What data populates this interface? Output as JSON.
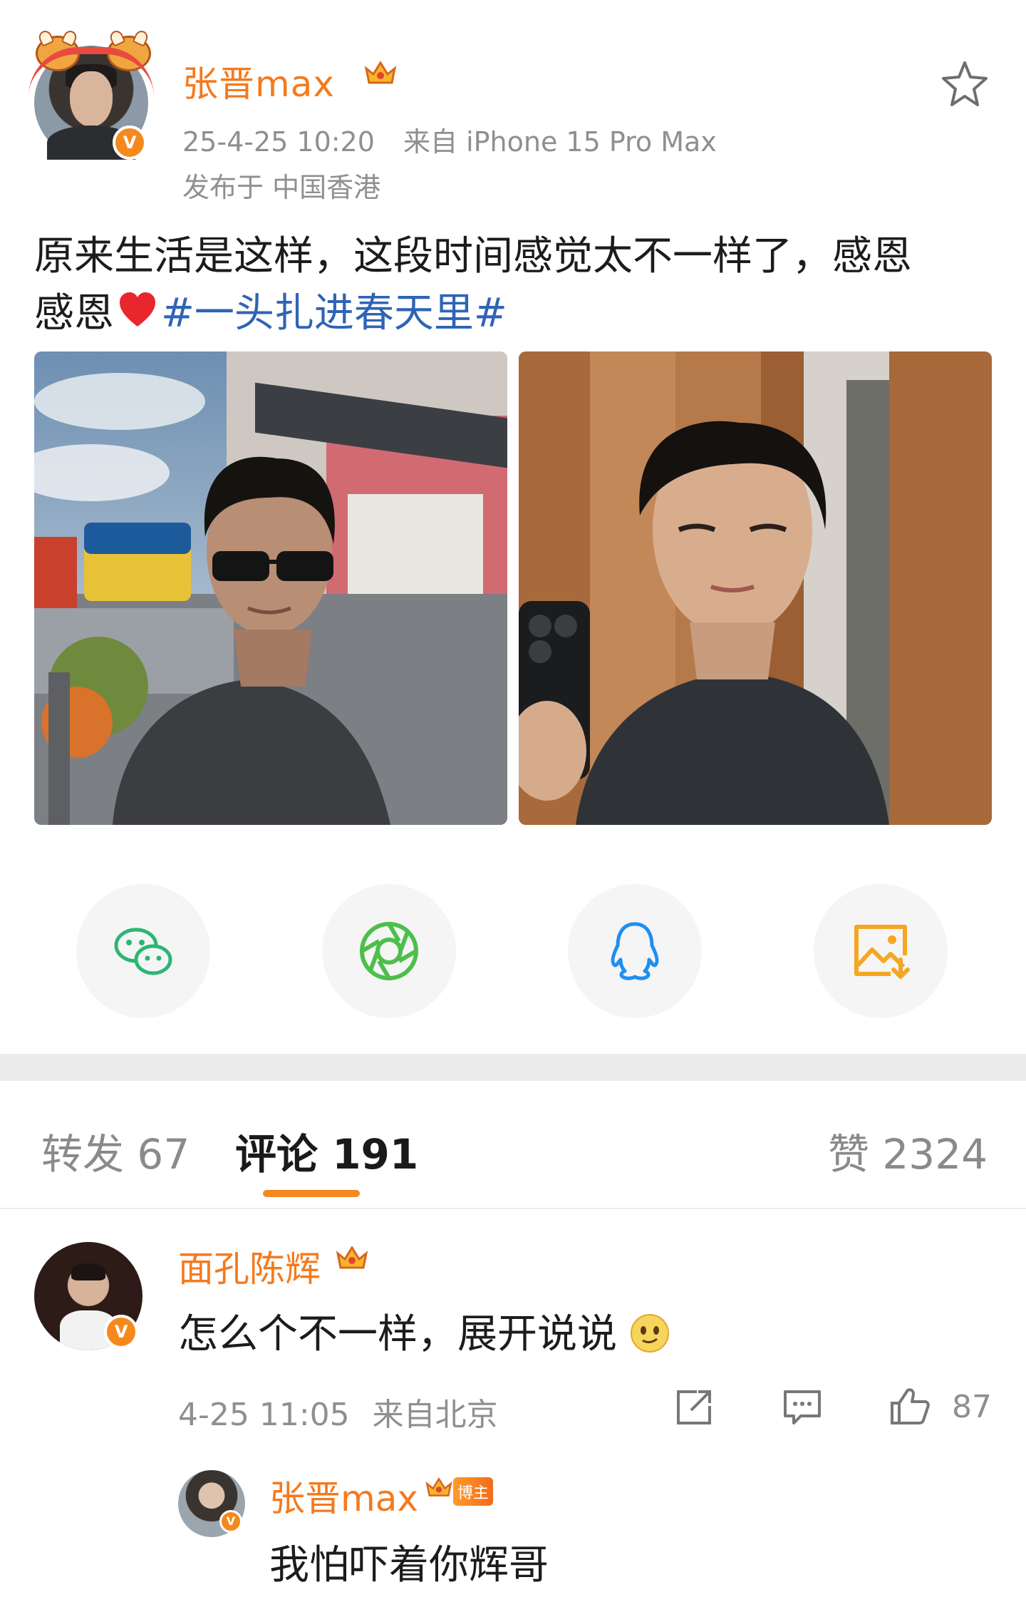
{
  "post": {
    "author": "张晋max",
    "timestamp": "25-4-25 10:20",
    "source": "来自 iPhone 15 Pro Max",
    "location": "发布于 中国香港",
    "text_main": "原来生活是这样，这段时间感觉太不一样了，感恩",
    "text_cont": "感恩",
    "hashtag": "#一头扎进春天里#",
    "verified_mark": "V"
  },
  "share": {
    "items": [
      "wechat-icon",
      "moments-icon",
      "qq-icon",
      "save-image-icon"
    ]
  },
  "tabs": [
    {
      "label": "转发 67"
    },
    {
      "label": "评论 191"
    },
    {
      "label": "赞 2324"
    }
  ],
  "comments": [
    {
      "author": "面孔陈辉",
      "text": "怎么个不一样，展开说说",
      "time": "4-25 11:05",
      "location": "来自北京",
      "likes": "87",
      "verified_mark": "V"
    }
  ],
  "reply": {
    "author": "张晋max",
    "badge": "博主",
    "text": "我怕吓着你辉哥",
    "verified_mark": "V"
  },
  "colors": {
    "accent": "#f57a1e",
    "hashtag": "#2f64b5",
    "meta": "#8f8f8f"
  }
}
